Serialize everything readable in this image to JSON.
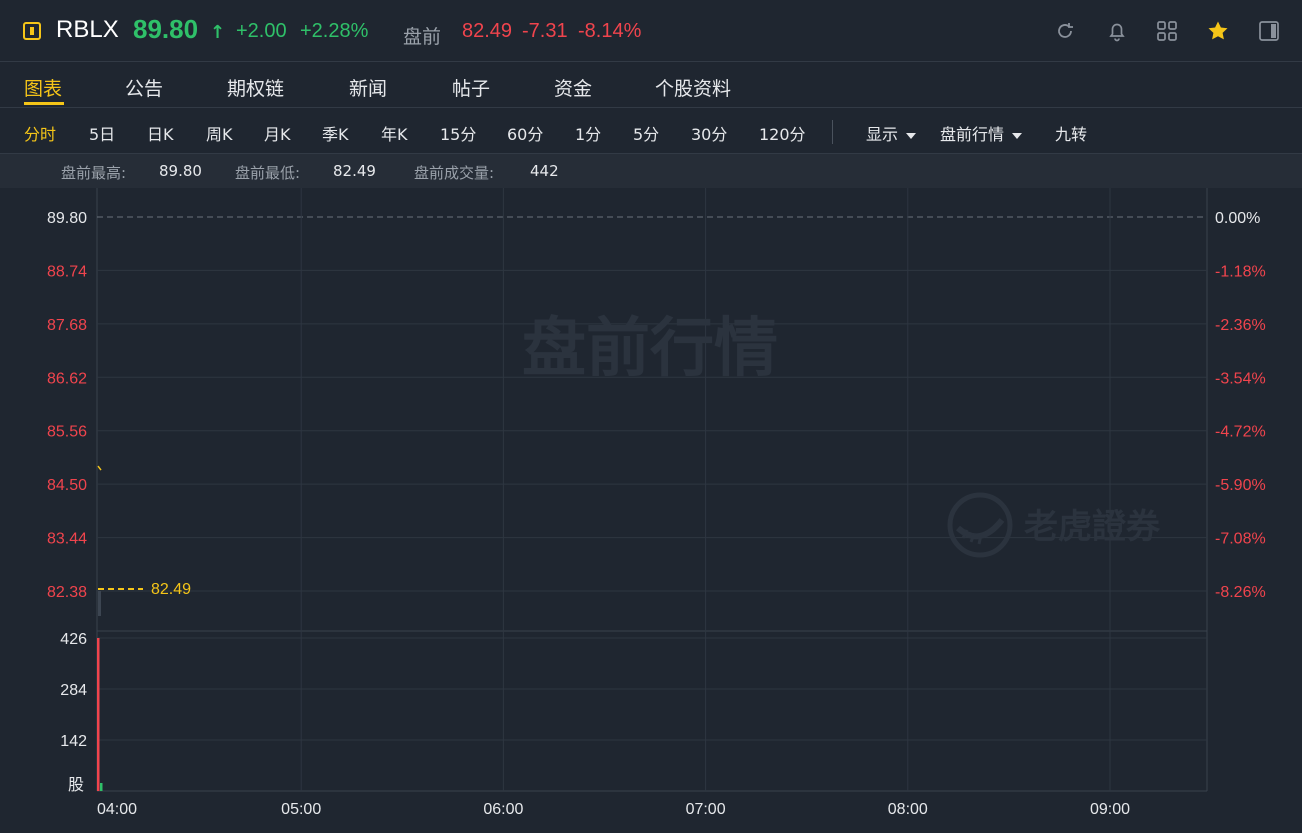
{
  "header": {
    "ticker": "RBLX",
    "price": "89.80",
    "price_arrow": "↑",
    "change": "+2.00",
    "change_pct": "+2.28%",
    "premarket_label": "盘前",
    "premarket_price": "82.49",
    "premarket_change": "-7.31",
    "premarket_change_pct": "-8.14%",
    "icons": [
      "refresh-icon",
      "bell-icon",
      "grid-icon",
      "star-icon",
      "panel-icon"
    ]
  },
  "tabs": [
    "图表",
    "公告",
    "期权链",
    "新闻",
    "帖子",
    "资金",
    "个股资料"
  ],
  "active_tab": "图表",
  "toolbar": {
    "periods": [
      "分时",
      "5日",
      "日K",
      "周K",
      "月K",
      "季K",
      "年K",
      "15分",
      "60分",
      "1分",
      "5分",
      "30分",
      "120分"
    ],
    "active_period": "分时",
    "display": "显示",
    "premarket_quotes": "盘前行情",
    "nine_turn": "九转"
  },
  "stats": {
    "high_label": "盘前最高:",
    "high": "89.80",
    "low_label": "盘前最低:",
    "low": "82.49",
    "volume_label": "盘前成交量:",
    "volume": "442"
  },
  "chart": {
    "watermark": "盘前行情",
    "brand": "老虎證券",
    "current_label": "82.49",
    "volume_unit": "股",
    "colors": {
      "up": "#2fc069",
      "down": "#f0444d",
      "accent": "#f5c518",
      "neutral": "#e6e8eb"
    }
  },
  "chart_data": {
    "type": "line",
    "y_left_ticks": [
      "89.80",
      "88.74",
      "87.68",
      "86.62",
      "85.56",
      "84.50",
      "83.44",
      "82.38"
    ],
    "y_right_ticks": [
      "0.00%",
      "-1.18%",
      "-2.36%",
      "-3.54%",
      "-4.72%",
      "-5.90%",
      "-7.08%",
      "-8.26%"
    ],
    "x_ticks": [
      "04:00",
      "05:00",
      "06:00",
      "07:00",
      "08:00",
      "09:00"
    ],
    "ylim": [
      82.38,
      89.8
    ],
    "prev_close": 89.8,
    "current_price": 82.49,
    "volume_ticks": [
      "426",
      "284",
      "142"
    ],
    "volume_max": 426,
    "series": [
      {
        "time": "04:00",
        "price": 84.7,
        "volume": 426
      }
    ]
  }
}
